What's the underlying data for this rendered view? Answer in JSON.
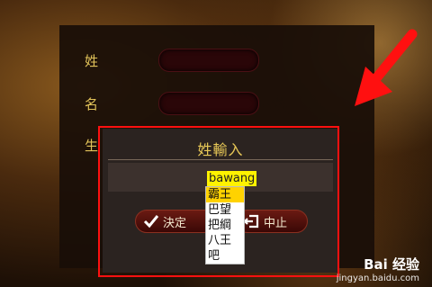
{
  "form": {
    "surname_label": "姓",
    "givenname_label": "名",
    "third_label_partial": "生"
  },
  "dialog": {
    "title": "姓輸入",
    "ok_label": "決定",
    "cancel_label": "中止"
  },
  "ime": {
    "typed_text": "bawang",
    "candidates": [
      "霸王",
      "巴望",
      "把綱",
      "八王",
      "吧"
    ],
    "selected_index": 0
  },
  "watermark": {
    "brand": "Bai 经验",
    "url": "jingyan.baidu.com"
  },
  "colors": {
    "label_gold": "#e2c35a",
    "highlight_red": "#ff1010",
    "ime_highlight": "#fff200"
  }
}
